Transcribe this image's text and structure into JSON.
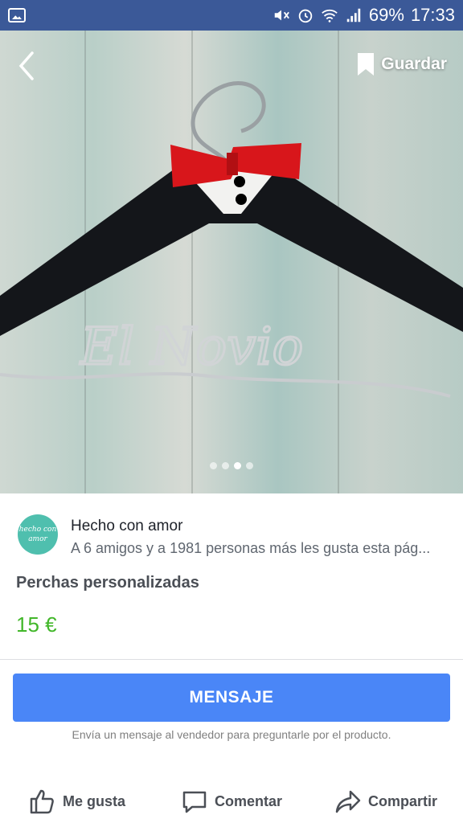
{
  "status_bar": {
    "battery": "69%",
    "time": "17:33",
    "icons": [
      "gallery-icon",
      "mute-icon",
      "alarm-icon",
      "wifi-icon",
      "signal-icon"
    ]
  },
  "hero": {
    "save_label": "Guardar",
    "hanger_text": "El Novio",
    "carousel": {
      "count": 4,
      "active": 3
    }
  },
  "seller": {
    "name": "Hecho con amor",
    "likes": "A 6 amigos y a 1981 personas más les gusta esta pág...",
    "avatar_text": "hecho con amor"
  },
  "product": {
    "title": "Perchas personalizadas",
    "price": "15 €"
  },
  "message_button": "MENSAJE",
  "message_hint": "Envía un mensaje al vendedor para preguntarle por el producto.",
  "actions": {
    "like": "Me gusta",
    "comment": "Comentar",
    "share": "Compartir"
  },
  "colors": {
    "status_bar": "#3b5998",
    "button": "#4a86f7",
    "price": "#42b72a"
  }
}
